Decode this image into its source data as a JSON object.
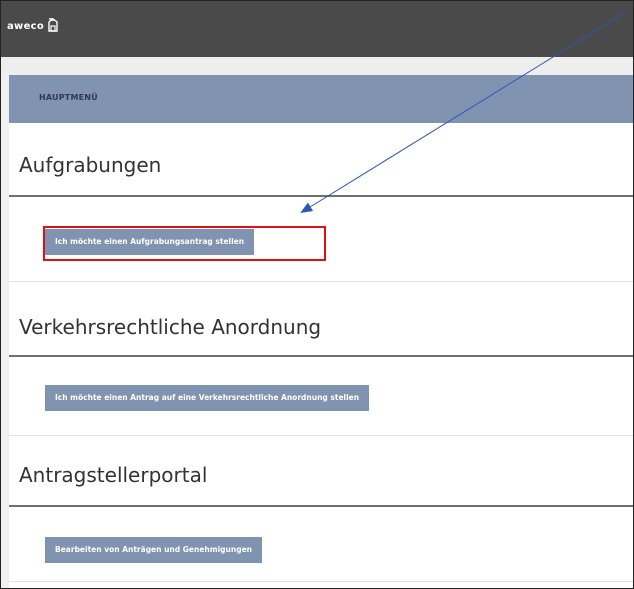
{
  "header": {
    "logo_text": "aweco",
    "logo_icon": "house-icon"
  },
  "menu": {
    "label": "HAUPTMENÜ"
  },
  "sections": [
    {
      "title": "Aufgrabungen",
      "button_label": "Ich möchte einen Aufgrabungsantrag stellen"
    },
    {
      "title": "Verkehrsrechtliche Anordnung",
      "button_label": "Ich möchte einen Antrag auf eine Verkehrsrechtliche Anordnung stellen"
    },
    {
      "title": "Antragstellerportal",
      "button_label": "Bearbeiten von Anträgen und Genehmigungen"
    }
  ],
  "colors": {
    "topbar": "#4a4a4a",
    "accent": "#8093b1",
    "highlight": "#e01010",
    "arrow": "#2f55b8"
  }
}
